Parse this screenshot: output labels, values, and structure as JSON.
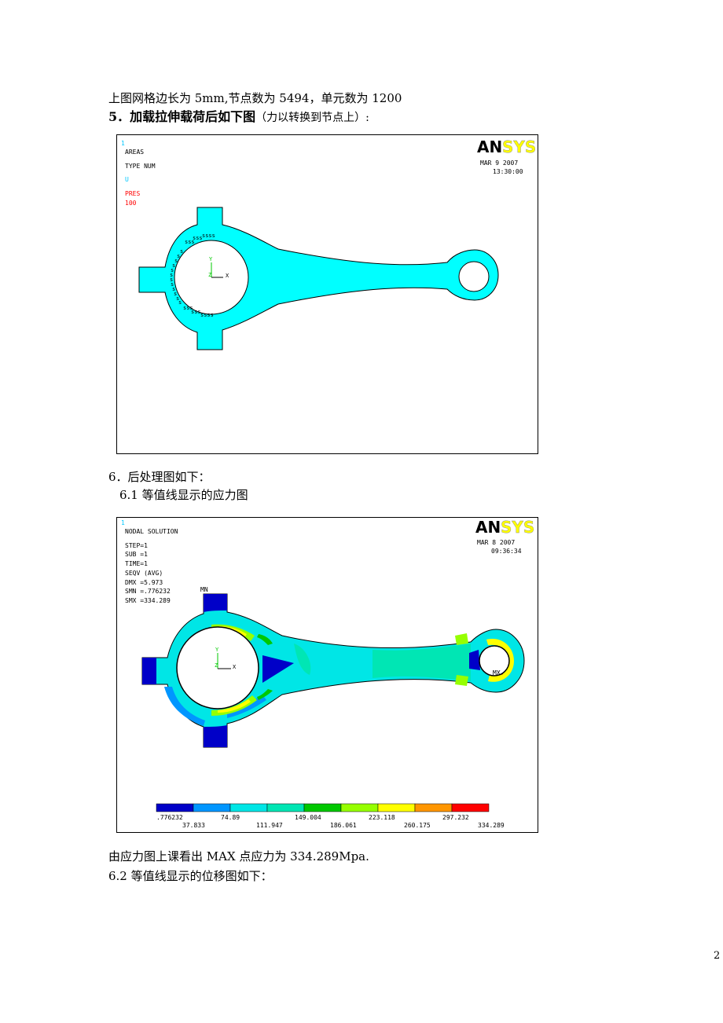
{
  "doc": {
    "line1": "上图网格边长为 5mm,节点数为 5494，单元数为 1200",
    "heading5_bold": "5．加载拉伸载荷后如下图",
    "heading5_paren": "（力以转换到节点上）:",
    "sec6": "6．后处理图如下：",
    "sec61": "6.1 等值线显示的应力图",
    "result_line": "由应力图上课看出 MAX 点应力为 334.289Mpa.",
    "sec62": "6.2  等值线显示的位移图如下：",
    "page_number": "2"
  },
  "figure1": {
    "window_num": "1",
    "line_areas": "AREAS",
    "line_type": "TYPE NUM",
    "line_u": "U",
    "line_pres": "PRES",
    "line_100": "100",
    "logo_an": "AN",
    "logo_sys": "SYS",
    "date": "MAR  9 2007",
    "time": "13:30:00",
    "axis_y": "Y",
    "axis_z": "Z",
    "axis_x": "X",
    "colors": {
      "fill": "#00ffff",
      "header_u": "#00c8ff",
      "pres": "#ff0000"
    }
  },
  "figure2": {
    "window_num": "1",
    "line_title": "NODAL SOLUTION",
    "line_step": "STEP=1",
    "line_sub": "SUB =1",
    "line_time": "TIME=1",
    "line_seqv": "SEQV     (AVG)",
    "line_dmx": "DMX =5.973",
    "line_smn": "SMN =.776232",
    "line_smx": "SMX =334.289",
    "logo_an": "AN",
    "logo_sys": "SYS",
    "date": "MAR  8 2007",
    "time": "09:36:34",
    "mn_label": "MN",
    "mx_label": "MX",
    "axis_y": "Y",
    "axis_z": "Z",
    "axis_x": "X",
    "legend_colors": [
      "#0000c8",
      "#0096ff",
      "#00e6e6",
      "#00e6b4",
      "#00c800",
      "#96ff00",
      "#ffff00",
      "#ff9600",
      "#ff0000"
    ],
    "legend_top_labels": [
      ".776232",
      "74.89",
      "149.004",
      "223.118",
      "297.232"
    ],
    "legend_bottom_labels": [
      "37.833",
      "111.947",
      "186.061",
      "260.175",
      "334.289"
    ]
  }
}
